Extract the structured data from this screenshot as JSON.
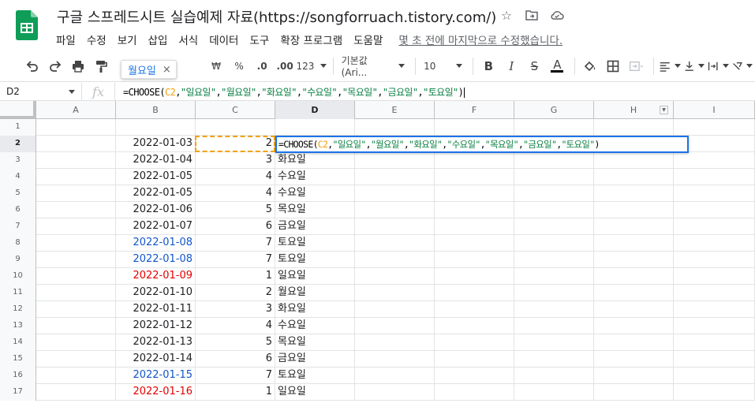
{
  "header": {
    "title": "구글 스프레드시트 실습예제 자료(https://songforruach.tistory.com/)",
    "menus": [
      "파일",
      "수정",
      "보기",
      "삽입",
      "서식",
      "데이터",
      "도구",
      "확장 프로그램",
      "도움말"
    ],
    "last_edit": "몇 초 전에 마지막으로 수정했습니다."
  },
  "toolbar": {
    "percent": "%",
    "dec_less": ".0",
    "dec_more": ".00",
    "number_format": "123",
    "font": "기본값 (Ari...",
    "font_size": "10",
    "currency": "₩",
    "bold": "B",
    "italic": "I",
    "strike": "S",
    "text_color": "A"
  },
  "tooltip": {
    "label": "월요일",
    "close": "×"
  },
  "formula_bar": {
    "name_box": "D2",
    "fx": "fx",
    "formula_parts": [
      {
        "t": "=CHOOSE(",
        "k": "black"
      },
      {
        "t": "C2",
        "k": "ref"
      },
      {
        "t": ",",
        "k": "black"
      },
      {
        "t": "\"일요일\"",
        "k": "str"
      },
      {
        "t": ",",
        "k": "black"
      },
      {
        "t": "\"월요일\"",
        "k": "str"
      },
      {
        "t": ",",
        "k": "black"
      },
      {
        "t": "\"화요일\"",
        "k": "str"
      },
      {
        "t": ",",
        "k": "black"
      },
      {
        "t": "\"수요일\"",
        "k": "str"
      },
      {
        "t": ",",
        "k": "black"
      },
      {
        "t": "\"목요일\"",
        "k": "str"
      },
      {
        "t": ",",
        "k": "black"
      },
      {
        "t": "\"금요일\"",
        "k": "str"
      },
      {
        "t": ",",
        "k": "black"
      },
      {
        "t": "\"토요일\"",
        "k": "str"
      },
      {
        "t": ")",
        "k": "black"
      }
    ]
  },
  "grid": {
    "columns": [
      "A",
      "B",
      "C",
      "D",
      "E",
      "F",
      "G",
      "H",
      "I"
    ],
    "active_column": "D",
    "active_row": "2",
    "rows": [
      {
        "n": "1",
        "b": "",
        "b_color": "",
        "c": "",
        "d": ""
      },
      {
        "n": "2",
        "b": "2022-01-03",
        "b_color": "",
        "c": "2",
        "d": ""
      },
      {
        "n": "3",
        "b": "2022-01-04",
        "b_color": "",
        "c": "3",
        "d": "화요일"
      },
      {
        "n": "4",
        "b": "2022-01-05",
        "b_color": "",
        "c": "4",
        "d": "수요일"
      },
      {
        "n": "5",
        "b": "2022-01-05",
        "b_color": "",
        "c": "4",
        "d": "수요일"
      },
      {
        "n": "6",
        "b": "2022-01-06",
        "b_color": "",
        "c": "5",
        "d": "목요일"
      },
      {
        "n": "7",
        "b": "2022-01-07",
        "b_color": "",
        "c": "6",
        "d": "금요일"
      },
      {
        "n": "8",
        "b": "2022-01-08",
        "b_color": "blue",
        "c": "7",
        "d": "토요일"
      },
      {
        "n": "9",
        "b": "2022-01-08",
        "b_color": "blue",
        "c": "7",
        "d": "토요일"
      },
      {
        "n": "10",
        "b": "2022-01-09",
        "b_color": "red",
        "c": "1",
        "d": "일요일"
      },
      {
        "n": "11",
        "b": "2022-01-10",
        "b_color": "",
        "c": "2",
        "d": "월요일"
      },
      {
        "n": "12",
        "b": "2022-01-11",
        "b_color": "",
        "c": "3",
        "d": "화요일"
      },
      {
        "n": "13",
        "b": "2022-01-12",
        "b_color": "",
        "c": "4",
        "d": "수요일"
      },
      {
        "n": "14",
        "b": "2022-01-13",
        "b_color": "",
        "c": "5",
        "d": "목요일"
      },
      {
        "n": "15",
        "b": "2022-01-14",
        "b_color": "",
        "c": "6",
        "d": "금요일"
      },
      {
        "n": "16",
        "b": "2022-01-15",
        "b_color": "blue",
        "c": "7",
        "d": "토요일"
      },
      {
        "n": "17",
        "b": "2022-01-16",
        "b_color": "red",
        "c": "1",
        "d": "일요일"
      }
    ]
  },
  "colors": {
    "sheets_green": "#0f9d58",
    "selection_blue": "#1a73e8",
    "reference_orange": "#f0a30a",
    "string_green": "#0b8043",
    "saturday_blue": "#1155cc",
    "sunday_red": "#e60000"
  }
}
